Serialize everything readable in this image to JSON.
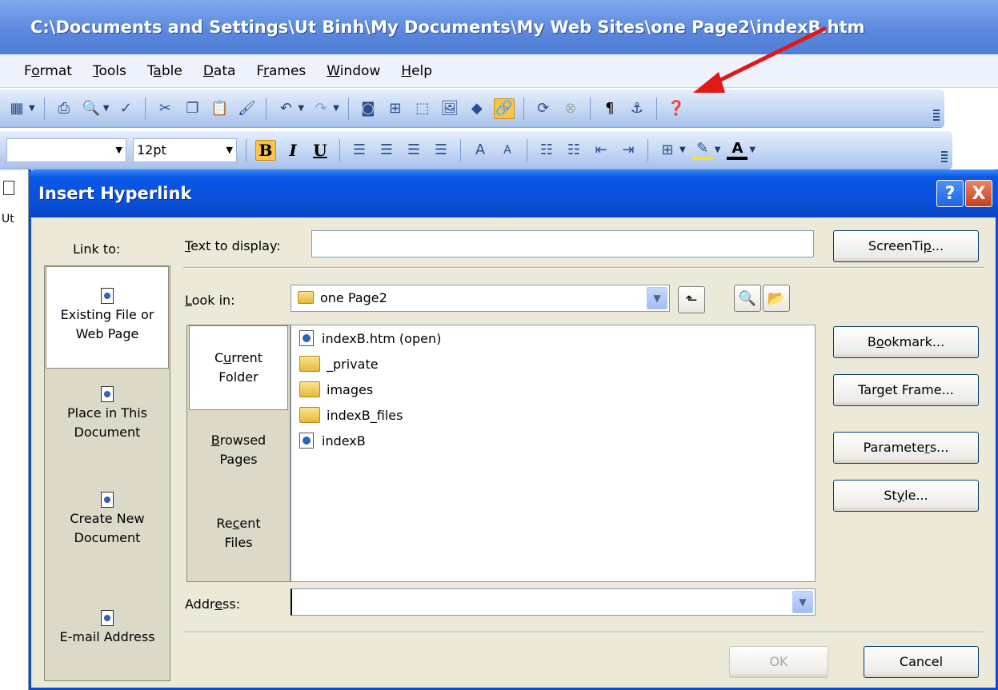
{
  "window": {
    "title": "C:\\Documents and Settings\\Ut Binh\\My Documents\\My Web Sites\\one Page2\\indexB.htm"
  },
  "menu": {
    "items": [
      {
        "pre": "F",
        "ul": "o",
        "post": "rmat"
      },
      {
        "pre": "",
        "ul": "T",
        "post": "ools"
      },
      {
        "pre": "T",
        "ul": "a",
        "post": "ble"
      },
      {
        "pre": "",
        "ul": "D",
        "post": "ata"
      },
      {
        "pre": "F",
        "ul": "r",
        "post": "ames"
      },
      {
        "pre": "",
        "ul": "W",
        "post": "indow"
      },
      {
        "pre": "",
        "ul": "H",
        "post": "elp"
      }
    ]
  },
  "formatting": {
    "font_size": "12pt",
    "bold": "B",
    "italic": "I",
    "underline": "U"
  },
  "dialog": {
    "title": "Insert Hyperlink",
    "help": "?",
    "close": "X",
    "link_to_label": "Link to:",
    "link_to": {
      "existing": "Existing File or Web Page",
      "place": "Place in This Document",
      "new": "Create New Document",
      "email": "E-mail Address"
    },
    "text_to_display": {
      "label_u": "T",
      "label_rest": "ext to display:",
      "value": ""
    },
    "screentip": {
      "pre": "ScreenTi",
      "ul": "p",
      "post": "..."
    },
    "look_in": {
      "label_u": "L",
      "label_rest": "ook in:",
      "value": "one Page2"
    },
    "tabs": {
      "current": {
        "pre": "C",
        "ul": "u",
        "post": "rrent",
        "line2": "Folder"
      },
      "browsed": {
        "pre": "",
        "ul": "B",
        "post": "rowsed",
        "line2": "Pages"
      },
      "recent": {
        "pre": "Re",
        "ul": "c",
        "post": "ent",
        "line2": "Files"
      }
    },
    "files": [
      {
        "name": "indexB.htm (open)",
        "kind": "htm"
      },
      {
        "name": "_private",
        "kind": "folder"
      },
      {
        "name": "images",
        "kind": "folder"
      },
      {
        "name": "indexB_files",
        "kind": "folder"
      },
      {
        "name": "indexB",
        "kind": "htm"
      }
    ],
    "buttons": {
      "bookmark": {
        "pre": "B",
        "ul": "o",
        "post": "okmark..."
      },
      "target": {
        "pre": "Tar",
        "ul": "g",
        "post": "et Frame..."
      },
      "parameters": {
        "pre": "Paramete",
        "ul": "r",
        "post": "s..."
      },
      "style": {
        "pre": "St",
        "ul": "y",
        "post": "le..."
      },
      "ok": "OK",
      "cancel": "Cancel"
    },
    "address": {
      "pre": "Addr",
      "ul": "e",
      "post": "ss:",
      "value": ""
    }
  },
  "doc_strip_text": "Ut"
}
